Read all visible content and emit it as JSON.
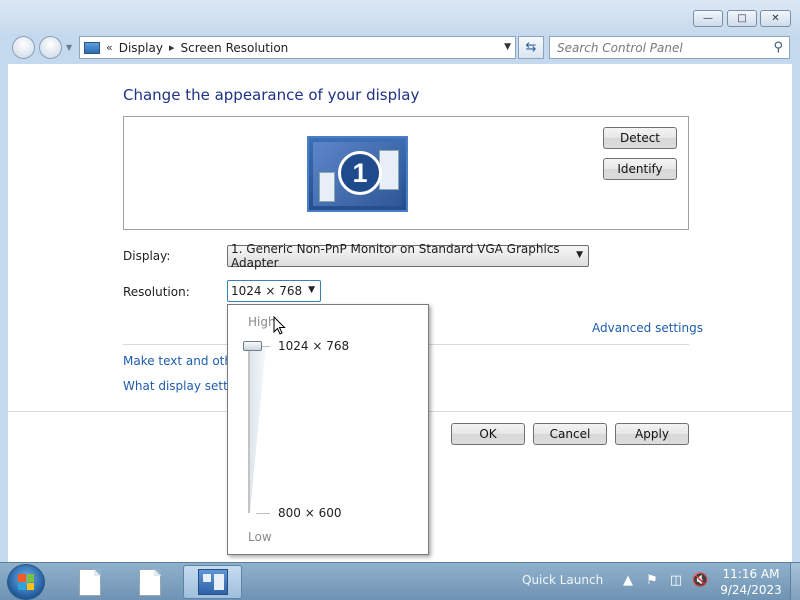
{
  "window": {
    "minimize_icon": "minimize-icon",
    "maximize_icon": "maximize-icon",
    "close_icon": "close-icon"
  },
  "addressbar": {
    "breadcrumb_prefix": "«",
    "breadcrumb": [
      "Display",
      "Screen Resolution"
    ],
    "search_placeholder": "Search Control Panel"
  },
  "main": {
    "heading": "Change the appearance of your display",
    "monitor_number": "1",
    "detect_label": "Detect",
    "identify_label": "Identify",
    "display_label": "Display:",
    "display_value": "1. Generic Non-PnP Monitor on Standard VGA Graphics Adapter",
    "resolution_label": "Resolution:",
    "resolution_value": "1024 × 768",
    "advanced_link": "Advanced settings",
    "text_link": "Make text and other",
    "what_link": "What display setting",
    "ok_label": "OK",
    "cancel_label": "Cancel",
    "apply_label": "Apply"
  },
  "resolution_dropdown": {
    "high_label": "High",
    "low_label": "Low",
    "top_value": "1024 × 768",
    "bottom_value": "800 × 600",
    "selected_fraction": 1.0
  },
  "taskbar": {
    "quick_launch": "Quick Launch",
    "time": "11:16 AM",
    "date": "9/24/2023"
  },
  "colors": {
    "accent": "#1e3287",
    "link": "#1e5cb0",
    "taskbar": "#7d9fbe"
  }
}
